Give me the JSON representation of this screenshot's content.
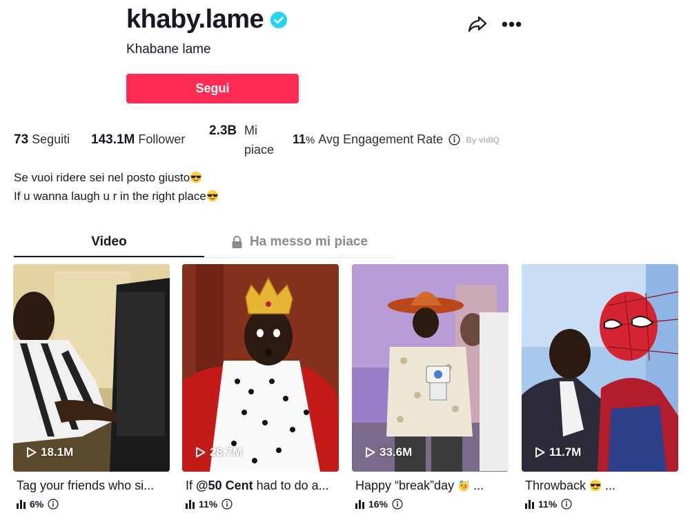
{
  "profile": {
    "username": "khaby.lame",
    "nickname": "Khabane lame",
    "follow_label": "Segui",
    "verified_color": "#20d5ec"
  },
  "header_icons": {
    "share": "share-icon",
    "more": "more-icon",
    "more_glyph": "•••"
  },
  "stats": {
    "following_count": "73",
    "following_label": "Seguiti",
    "followers_count": "143.1M",
    "followers_label": "Follower",
    "likes_count": "2.3B",
    "likes_label_1": "Mi",
    "likes_label_2": "piace",
    "engagement_value": "11",
    "engagement_unit": "%",
    "engagement_label": "Avg Engagement Rate",
    "byline": "By vidIQ"
  },
  "bio": {
    "line1": "Se vuoi ridere sei nel posto giusto",
    "line2": "If u wanna laugh u r in the right place",
    "emoji": "sunglasses-emoji"
  },
  "tabs": {
    "videos": "Video",
    "liked": "Ha messo mi piace"
  },
  "colors": {
    "accent": "#fe2c55",
    "text": "#161823",
    "muted": "#8a8b91"
  },
  "videos": [
    {
      "views": "18.1M",
      "caption_pre": "Tag your friends who si...",
      "caption_bold": "",
      "caption_post": "",
      "engagement": "6%"
    },
    {
      "views": "28.7M",
      "caption_pre": "If ",
      "caption_bold": "@50 Cent",
      "caption_post": " had to do a...",
      "engagement": "11%"
    },
    {
      "views": "33.6M",
      "caption_pre": "Happy “break”day ",
      "caption_bold": "",
      "caption_post": " ...",
      "engagement": "16%"
    },
    {
      "views": "11.7M",
      "caption_pre": "Throwback ",
      "caption_bold": "",
      "caption_post": " ...",
      "engagement": "11%"
    }
  ]
}
